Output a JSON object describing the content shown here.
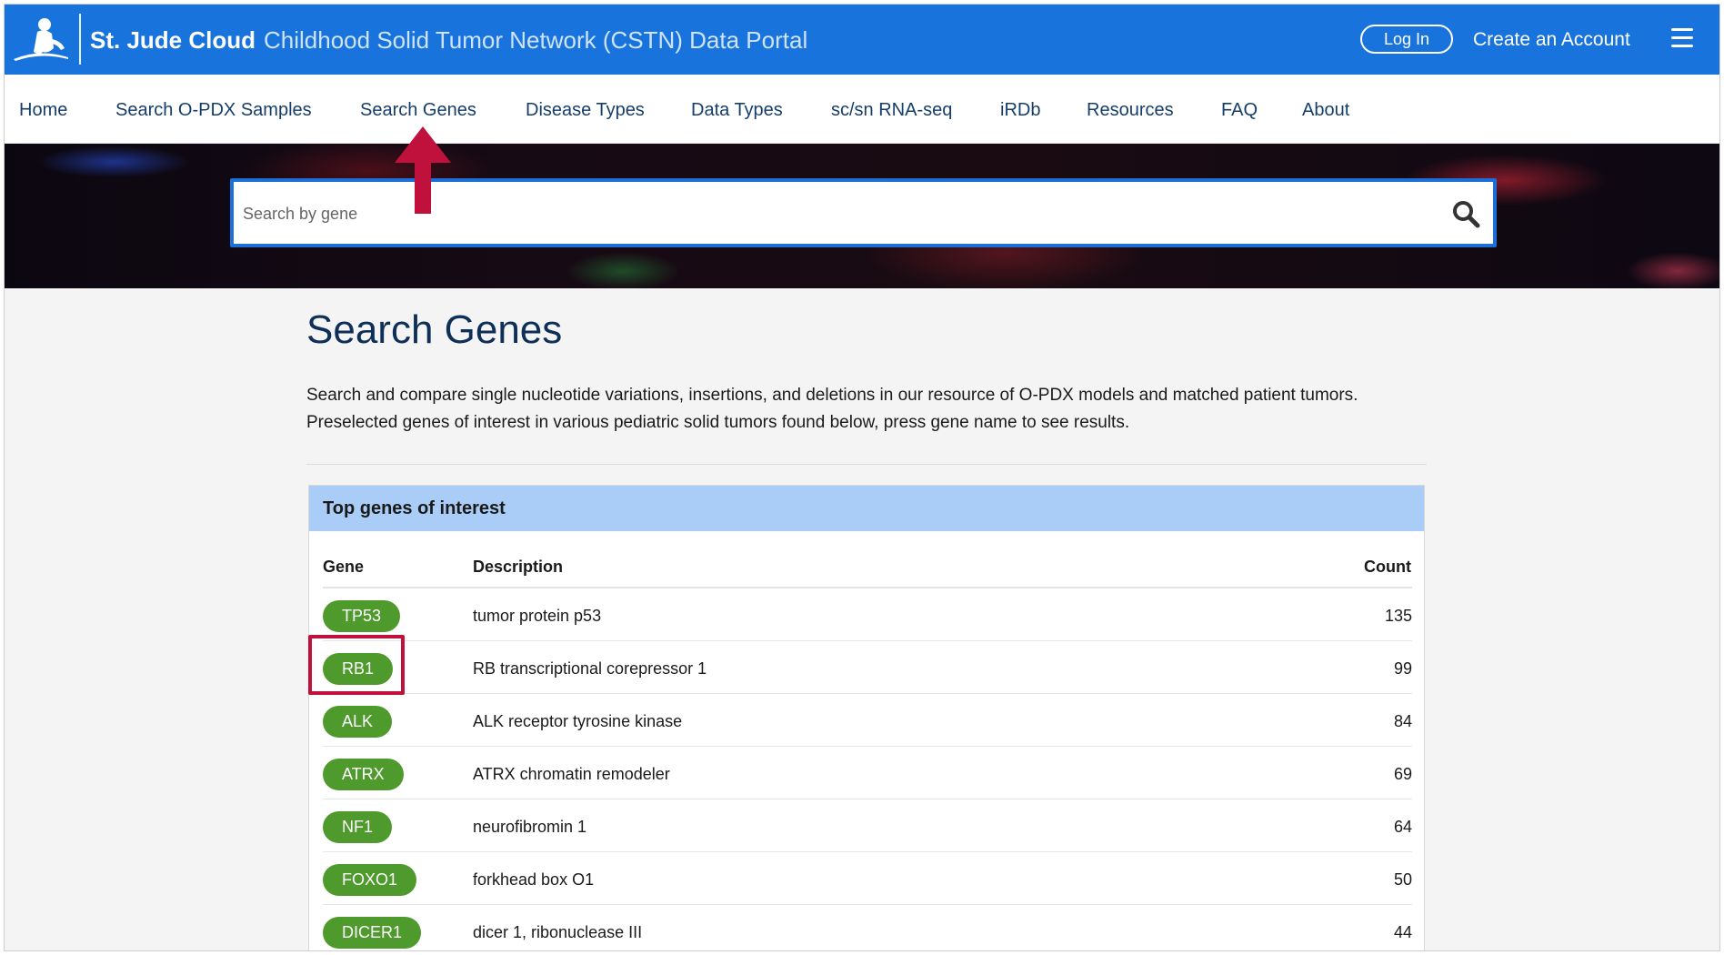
{
  "header": {
    "brand": "St. Jude Cloud",
    "portal_title": "Childhood Solid Tumor Network (CSTN) Data Portal",
    "login_label": "Log In",
    "create_account_label": "Create an Account",
    "logo_icon": "st-jude-logo",
    "menu_icon": "hamburger-menu-icon"
  },
  "nav": {
    "items": [
      {
        "label": "Home"
      },
      {
        "label": "Search O-PDX Samples"
      },
      {
        "label": "Search Genes"
      },
      {
        "label": "Disease Types"
      },
      {
        "label": "Data Types"
      },
      {
        "label": "sc/sn RNA-seq"
      },
      {
        "label": "iRDb"
      },
      {
        "label": "Resources"
      },
      {
        "label": "FAQ"
      },
      {
        "label": "About"
      }
    ]
  },
  "search": {
    "placeholder": "Search by gene",
    "value": ""
  },
  "page": {
    "title": "Search Genes",
    "intro": "Search and compare single nucleotide variations, insertions, and deletions in our resource of O-PDX models and matched patient tumors. Preselected genes of interest in various pediatric solid tumors found below, press gene name to see results."
  },
  "table": {
    "title": "Top genes of interest",
    "columns": {
      "gene": "Gene",
      "description": "Description",
      "count": "Count"
    },
    "rows": [
      {
        "gene": "TP53",
        "description": "tumor protein p53",
        "count": "135"
      },
      {
        "gene": "RB1",
        "description": "RB transcriptional corepressor 1",
        "count": "99"
      },
      {
        "gene": "ALK",
        "description": "ALK receptor tyrosine kinase",
        "count": "84"
      },
      {
        "gene": "ATRX",
        "description": "ATRX chromatin remodeler",
        "count": "69"
      },
      {
        "gene": "NF1",
        "description": "neurofibromin 1",
        "count": "64"
      },
      {
        "gene": "FOXO1",
        "description": "forkhead box O1",
        "count": "50"
      },
      {
        "gene": "DICER1",
        "description": "dicer 1, ribonuclease III",
        "count": "44"
      }
    ]
  },
  "colors": {
    "header_blue": "#1874dc",
    "nav_text": "#163e6b",
    "title_navy": "#0e2f57",
    "table_head": "#a9cdf6",
    "gene_pill": "#4e9a2c",
    "annotation_red": "#c0103c"
  }
}
